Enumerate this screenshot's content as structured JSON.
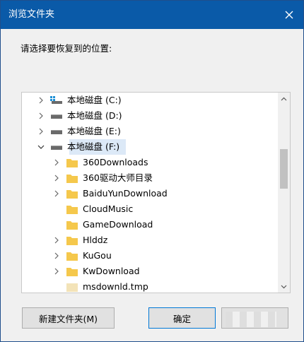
{
  "window": {
    "title": "浏览文件夹"
  },
  "prompt": "请选择要恢复到的位置:",
  "tree": {
    "drives": [
      {
        "label": "本地磁盘 (C:)",
        "icon": "system-drive-icon",
        "expanded": false
      },
      {
        "label": "本地磁盘 (D:)",
        "icon": "drive-icon",
        "expanded": false
      },
      {
        "label": "本地磁盘 (E:)",
        "icon": "drive-icon",
        "expanded": false
      },
      {
        "label": "本地磁盘 (F:)",
        "icon": "drive-icon",
        "expanded": true,
        "selected": true
      }
    ],
    "folders": [
      {
        "label": "360Downloads",
        "has_children": true
      },
      {
        "label": "360驱动大师目录",
        "has_children": true
      },
      {
        "label": "BaiduYunDownload",
        "has_children": true
      },
      {
        "label": "CloudMusic",
        "has_children": false
      },
      {
        "label": "GameDownload",
        "has_children": false
      },
      {
        "label": "Hlddz",
        "has_children": true
      },
      {
        "label": "KuGou",
        "has_children": true
      },
      {
        "label": "KwDownload",
        "has_children": true
      },
      {
        "label": "msdownld.tmp",
        "has_children": false
      }
    ]
  },
  "buttons": {
    "new_folder": "新建文件夹(M)",
    "ok": "确定",
    "cancel": ""
  },
  "colors": {
    "titlebar": "#0a5aa8",
    "selection": "#dce9f7",
    "folder": "#f5c84c",
    "accent": "#0078d7"
  }
}
